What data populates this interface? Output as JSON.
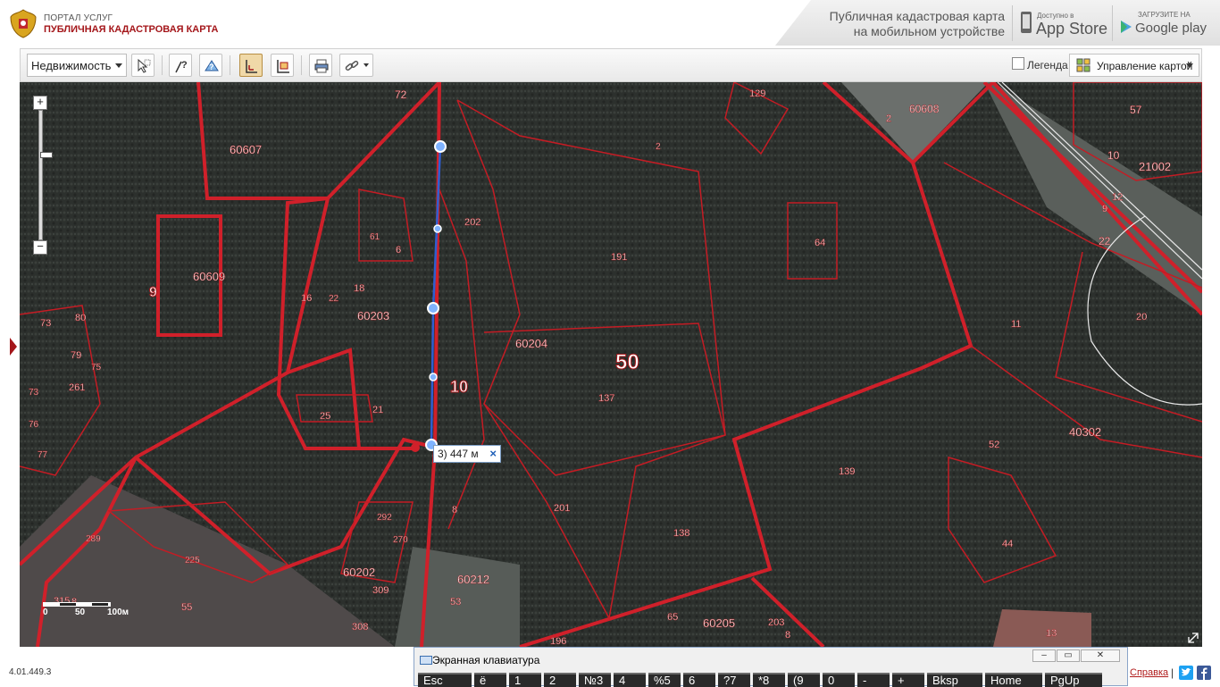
{
  "header": {
    "portal_subtitle": "ПОРТАЛ УСЛУГ",
    "portal_title": "ПУБЛИЧНАЯ КАДАСТРОВАЯ КАРТА",
    "promo_line1": "Публичная кадастровая карта",
    "promo_line2": "на мобильном устройстве",
    "appstore_small": "Доступно в",
    "appstore_big": "App Store",
    "googleplay_small": "ЗАГРУЗИТЕ НА",
    "googleplay_big": "Google play"
  },
  "toolbar": {
    "property_select": "Недвижимость",
    "legend_label": "Легенда",
    "map_management_label": "Управление картой"
  },
  "map": {
    "measure_label": "3) 447 м",
    "measure_close": "×",
    "scale_labels": [
      "0",
      "50",
      "100м"
    ],
    "parcel_labels": [
      {
        "text": "72"
      },
      {
        "text": "60607"
      },
      {
        "text": "202"
      },
      {
        "text": "129"
      },
      {
        "text": "2"
      },
      {
        "text": "60608"
      },
      {
        "text": "57"
      },
      {
        "text": "10"
      },
      {
        "text": "21002"
      },
      {
        "text": "12"
      },
      {
        "text": "9"
      },
      {
        "text": "22"
      },
      {
        "text": "191"
      },
      {
        "text": "64"
      },
      {
        "text": "2"
      },
      {
        "text": "61"
      },
      {
        "text": "6"
      },
      {
        "text": "18"
      },
      {
        "text": "16"
      },
      {
        "text": "22"
      },
      {
        "text": "60203"
      },
      {
        "text": "60609"
      },
      {
        "text": "9"
      },
      {
        "text": "73"
      },
      {
        "text": "80"
      },
      {
        "text": "79"
      },
      {
        "text": "75"
      },
      {
        "text": "261"
      },
      {
        "text": "73"
      },
      {
        "text": "76"
      },
      {
        "text": "77"
      },
      {
        "text": "60204"
      },
      {
        "text": "50"
      },
      {
        "text": "137"
      },
      {
        "text": "10"
      },
      {
        "text": "11"
      },
      {
        "text": "20"
      },
      {
        "text": "25"
      },
      {
        "text": "21"
      },
      {
        "text": "52"
      },
      {
        "text": "40302"
      },
      {
        "text": "139"
      },
      {
        "text": "8"
      },
      {
        "text": "201"
      },
      {
        "text": "138"
      },
      {
        "text": "292"
      },
      {
        "text": "270"
      },
      {
        "text": "44"
      },
      {
        "text": "289"
      },
      {
        "text": "225"
      },
      {
        "text": "60202"
      },
      {
        "text": "60212"
      },
      {
        "text": "309"
      },
      {
        "text": "315"
      },
      {
        "text": "8"
      },
      {
        "text": "55"
      },
      {
        "text": "53"
      },
      {
        "text": "308"
      },
      {
        "text": "65"
      },
      {
        "text": "60205"
      },
      {
        "text": "203"
      },
      {
        "text": "8"
      },
      {
        "text": "196"
      },
      {
        "text": "13"
      }
    ]
  },
  "footer": {
    "version": "4.01.449.3",
    "help_link": "Справка",
    "pipe": "|"
  },
  "keyboard": {
    "title": "Экранная клавиатура",
    "minimize": "–",
    "restore": "▭",
    "close": "✕",
    "keys": [
      "Esc",
      "ё",
      "1",
      "2",
      "№3",
      "4",
      "%5",
      "6",
      "?7",
      "*8",
      "(9",
      "0",
      "-",
      "+",
      "Bksp",
      "Home",
      "PgUp"
    ]
  },
  "colors": {
    "accent_red": "#a4161a",
    "parcel_line": "#d0202a",
    "measure_line": "#2f5fd0"
  }
}
